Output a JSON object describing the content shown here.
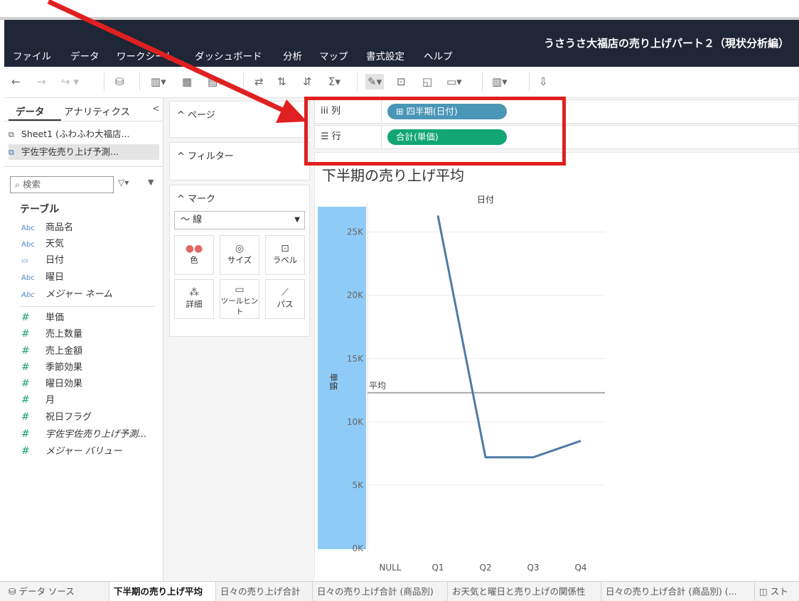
{
  "app_title": "うさうさ大福店の売り上げパート２（現状分析編）",
  "menu": [
    "ファイル",
    "データ",
    "ワークシート",
    "ダッシュボード",
    "分析",
    "マップ",
    "書式設定",
    "ヘルプ"
  ],
  "data_pane": {
    "tab_data": "データ",
    "tab_analytics": "アナリティクス",
    "datasources": [
      "Sheet1 (ふわふわ大福店...",
      "宇佐宇佐売り上げ予測..."
    ],
    "search_placeholder": "検索",
    "table_header": "テーブル",
    "dimensions": [
      {
        "type": "Abc",
        "name": "商品名"
      },
      {
        "type": "Abc",
        "name": "天気"
      },
      {
        "type": "date",
        "name": "日付"
      },
      {
        "type": "Abc",
        "name": "曜日"
      },
      {
        "type": "Abc",
        "name": "メジャー ネーム"
      }
    ],
    "measures": [
      "単価",
      "売上数量",
      "売上金額",
      "季節効果",
      "曜日効果",
      "月",
      "祝日フラグ",
      "宇佐宇佐売り上げ予測...",
      "メジャー バリュー"
    ]
  },
  "cards": {
    "pages": "ページ",
    "filters": "フィルター",
    "marks": "マーク",
    "mark_type": "線",
    "mark_buttons": [
      "色",
      "サイズ",
      "ラベル",
      "詳細",
      "ツールヒント",
      "パス"
    ]
  },
  "shelves": {
    "columns_label": "列",
    "columns_pill": "四半期(日付)",
    "rows_label": "行",
    "rows_pill": "合計(単価)"
  },
  "chart_data": {
    "type": "line",
    "title": "下半期の売り上げ平均",
    "header": "日付",
    "ylabel": "単価",
    "categories": [
      "NULL",
      "Q1",
      "Q2",
      "Q3",
      "Q4"
    ],
    "values": [
      null,
      26300,
      7200,
      7200,
      8500
    ],
    "y_ticks": [
      "0K",
      "5K",
      "10K",
      "15K",
      "20K",
      "25K"
    ],
    "ylim": [
      0,
      27000
    ],
    "reference_line": {
      "label": "平均",
      "value": 12300
    },
    "series_color": "#4f7aa6",
    "highlight_color": "#8fcbf7"
  },
  "sheet_tabs": [
    "データ ソース",
    "下半期の売り上げ平均",
    "日々の売り上げ合計",
    "日々の売り上げ合計 (商品別)",
    "お天気と曜日と売り上げの関係性",
    "日々の売り上げ合計 (商品別) (...",
    "スト"
  ],
  "active_tab": "下半期の売り上げ平均"
}
